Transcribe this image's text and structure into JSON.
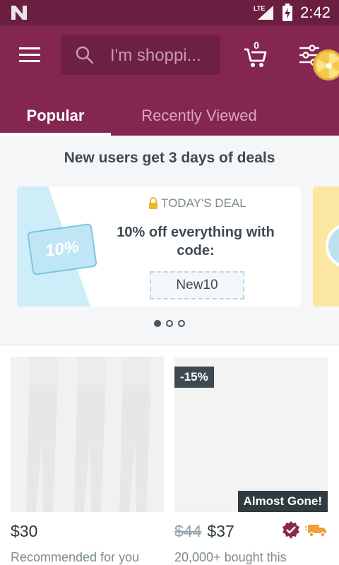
{
  "status_bar": {
    "time": "2:42",
    "network": "LTE"
  },
  "header": {
    "search_placeholder": "I'm shoppi...",
    "cart_count": "0"
  },
  "tabs": [
    {
      "label": "Popular",
      "active": true
    },
    {
      "label": "Recently Viewed",
      "active": false
    }
  ],
  "promo": {
    "title": "New users get 3 days of deals",
    "deal_tag": "TODAY'S DEAL",
    "ticket_text": "10%",
    "deal_text": "10% off everything with code:",
    "code": "New10",
    "carousel_pages": 3,
    "carousel_active": 0
  },
  "products": [
    {
      "price": "$30",
      "old_price": "",
      "subtitle": "Recommended for you",
      "discount_badge": "",
      "stock_badge": ""
    },
    {
      "price": "$37",
      "old_price": "$44",
      "subtitle": "20,000+ bought this",
      "discount_badge": "-15%",
      "stock_badge": "Almost Gone!"
    }
  ],
  "colors": {
    "status_bar": "#6b1f40",
    "app_bar": "#832650",
    "accent_truck": "#f0a040",
    "verified_badge": "#8a2a4a"
  },
  "icons": [
    "n-logo-icon",
    "lte-icon",
    "signal-icon",
    "battery-icon",
    "menu-icon",
    "search-icon",
    "cart-icon",
    "filter-icon",
    "prize-wheel-icon",
    "lock-icon",
    "verified-icon",
    "truck-icon"
  ]
}
